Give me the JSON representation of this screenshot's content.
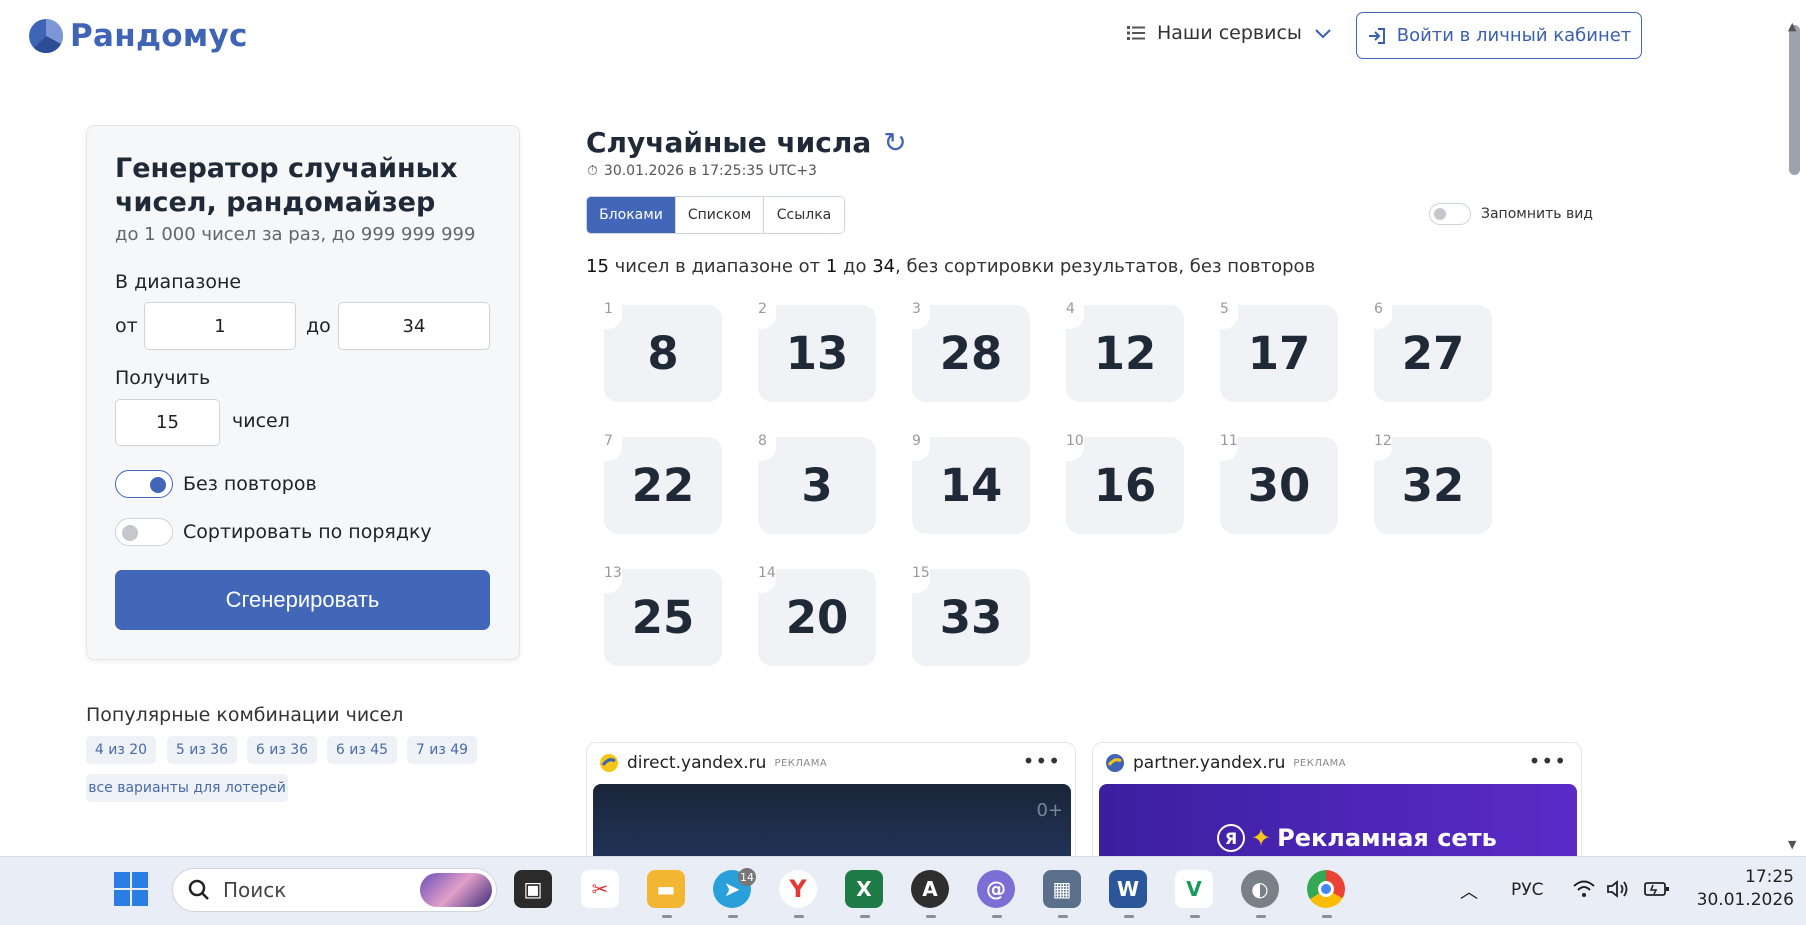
{
  "header": {
    "logo_text": "Рандомус",
    "services_label": "Наши сервисы",
    "login_label": "Войти в личный кабинет"
  },
  "form": {
    "title": "Генератор случайных чисел, рандомайзер",
    "subtitle": "до 1 000 чисел за раз, до 999 999 999",
    "range_label": "В диапазоне",
    "from_label": "от",
    "from_value": "1",
    "to_label": "до",
    "to_value": "34",
    "get_label": "Получить",
    "count_value": "15",
    "count_suffix": "чисел",
    "no_repeat_label": "Без повторов",
    "no_repeat_on": true,
    "sort_label": "Сортировать по порядку",
    "sort_on": false,
    "generate_label": "Сгенерировать"
  },
  "popular": {
    "title": "Популярные комбинации чисел",
    "chips": [
      "4 из 20",
      "5 из 36",
      "6 из 36",
      "6 из 45",
      "7 из 49",
      "все варианты для лотерей"
    ]
  },
  "result": {
    "title": "Случайные числа",
    "timestamp": "30.01.2026 в 17:25:35 UTC+3",
    "tabs": [
      "Блоками",
      "Списком",
      "Ссылка"
    ],
    "active_tab": 0,
    "remember_label": "Запомнить вид",
    "summary": {
      "count": "15",
      "t1": " чисел в диапазоне от ",
      "from": "1",
      "t2": " до ",
      "to": "34",
      "t3": ", без сортировки результатов, без повторов"
    },
    "numbers": [
      8,
      13,
      28,
      12,
      17,
      27,
      22,
      3,
      14,
      16,
      30,
      32,
      25,
      20,
      33
    ]
  },
  "ads": [
    {
      "domain": "direct.yandex.ru",
      "tag": "РЕКЛАМА",
      "badge": "0+"
    },
    {
      "domain": "partner.yandex.ru",
      "tag": "РЕКЛАМА",
      "banner_text": "Рекламная сеть",
      "banner_logo": "Я"
    }
  ],
  "taskbar": {
    "search_placeholder": "Поиск",
    "telegram_badge": "14",
    "language": "РУС",
    "time": "17:25",
    "date": "30.01.2026"
  },
  "colors": {
    "accent": "#4267b8",
    "block_bg": "#f0f2f5"
  }
}
